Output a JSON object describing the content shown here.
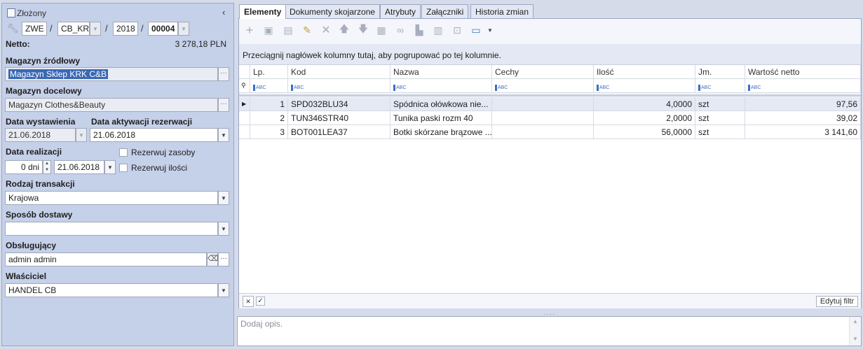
{
  "window": {
    "title": "Złożony",
    "collapse_icon": "chevron-left-icon"
  },
  "header": {
    "doc_type": "ZWE",
    "sep1": "/",
    "series": "CB_KRK",
    "sep2": "/",
    "year": "2018",
    "sep3": "/",
    "number": "00004",
    "netto_label": "Netto:",
    "netto_value": "3 278,18 PLN"
  },
  "form": {
    "source_wh_label": "Magazyn źródłowy",
    "source_wh_value": "Magazyn Sklep KRK C&B",
    "target_wh_label": "Magazyn docelowy",
    "target_wh_value": "Magazyn Clothes&Beauty",
    "issue_date_label": "Data wystawienia",
    "issue_date_value": "21.06.2018",
    "reservation_date_label": "Data aktywacji rezerwacji",
    "reservation_date_value": "21.06.2018",
    "realization_date_label": "Data realizacji",
    "realization_days": "0 dni",
    "realization_date_value": "21.06.2018",
    "reserve_resources_label": "Rezerwuj zasoby",
    "reserve_quantities_label": "Rezerwuj ilości",
    "transaction_type_label": "Rodzaj transakcji",
    "transaction_type_value": "Krajowa",
    "delivery_label": "Sposób dostawy",
    "delivery_value": "",
    "handler_label": "Obsługujący",
    "handler_value": "admin admin",
    "owner_label": "Właściciel",
    "owner_value": "HANDEL CB"
  },
  "tabs": [
    "Elementy",
    "Dokumenty skojarzone",
    "Atrybuty",
    "Załączniki",
    "Historia zmian"
  ],
  "toolbar": {
    "icons": [
      "add-icon",
      "add-from-list-icon",
      "add-from-folder-icon",
      "edit-icon",
      "delete-icon",
      "move-up-icon",
      "move-down-icon",
      "calculator-icon",
      "binoculars-icon",
      "warehouse-icon",
      "columns-icon",
      "fit-icon",
      "export-icon"
    ]
  },
  "grid": {
    "group_hint": "Przeciągnij nagłówek kolumny tutaj, aby pogrupować po tej kolumnie.",
    "columns": [
      "Lp.",
      "Kod",
      "Nazwa",
      "Cechy",
      "Ilość",
      "Jm.",
      "Wartość netto"
    ],
    "filter_placeholder": "ABC",
    "rows": [
      {
        "lp": "1",
        "kod": "SPD032BLU34",
        "nazwa": "Spódnica ołówkowa nie...",
        "cechy": "",
        "ilosc": "4,0000",
        "jm": "szt",
        "wartosc": "97,56"
      },
      {
        "lp": "2",
        "kod": "TUN346STR40",
        "nazwa": "Tunika paski rozm 40",
        "cechy": "",
        "ilosc": "2,0000",
        "jm": "szt",
        "wartosc": "39,02"
      },
      {
        "lp": "3",
        "kod": "BOT001LEA37",
        "nazwa": "Botki skórzane brązowe ...",
        "cechy": "",
        "ilosc": "56,0000",
        "jm": "szt",
        "wartosc": "3 141,60"
      }
    ],
    "edit_filter_label": "Edytuj filtr"
  },
  "description": {
    "placeholder": "Dodaj opis."
  }
}
